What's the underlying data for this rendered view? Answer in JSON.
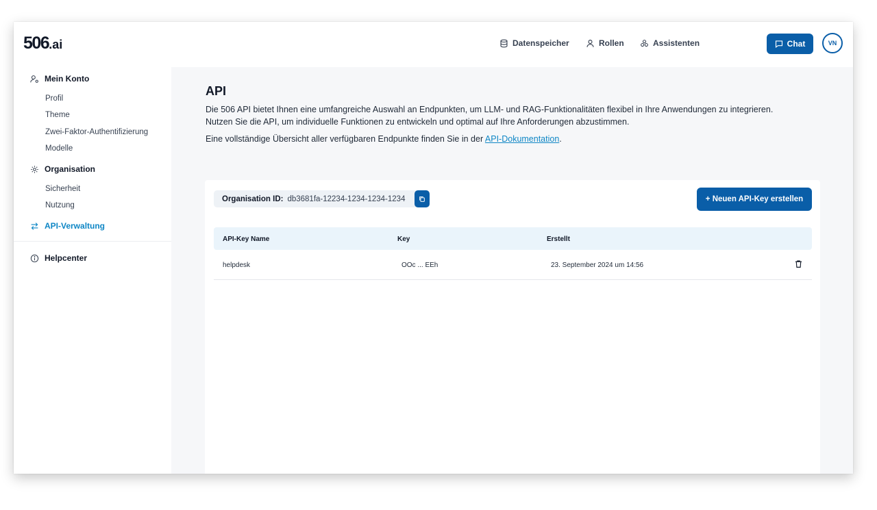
{
  "brand": {
    "logo_main": "506",
    "logo_suffix": ".ai"
  },
  "header": {
    "nav": [
      {
        "label": "Datenspeicher",
        "icon": "database-icon"
      },
      {
        "label": "Rollen",
        "icon": "user-icon"
      },
      {
        "label": "Assistenten",
        "icon": "assistants-icon"
      }
    ],
    "chat_label": "Chat",
    "avatar_initials": "VN"
  },
  "sidebar": {
    "account": {
      "title": "Mein Konto",
      "items": [
        "Profil",
        "Theme",
        "Zwei-Faktor-Authentifizierung",
        "Modelle"
      ]
    },
    "organisation": {
      "title": "Organisation",
      "items": [
        "Sicherheit",
        "Nutzung"
      ]
    },
    "api": {
      "title": "API-Verwaltung",
      "active": true
    },
    "help": {
      "title": "Helpcenter"
    }
  },
  "main": {
    "title": "API",
    "desc_line1": "Die 506 API bietet Ihnen eine umfangreiche Auswahl an Endpunkten, um LLM- und RAG-Funktionalitäten flexibel in Ihre Anwendungen zu integrieren.",
    "desc_line2": "Nutzen Sie die API, um individuelle Funktionen zu entwickeln und optimal auf Ihre Anforderungen abzustimmen.",
    "desc_line3_prefix": "Eine vollständige Übersicht aller verfügbaren Endpunkte finden Sie in der ",
    "desc_link": "API-Dokumentation",
    "desc_line3_suffix": "."
  },
  "org": {
    "label": "Organisation ID:",
    "value": "db3681fa-12234-1234-1234-1234"
  },
  "new_key_label": "+ Neuen API-Key erstellen",
  "table": {
    "headers": [
      "API-Key Name",
      "Key",
      "Erstellt"
    ],
    "rows": [
      {
        "name": "helpdesk",
        "key": "OOc ... EEh",
        "created": "23. September 2024 um 14:56"
      }
    ]
  },
  "colors": {
    "primary": "#0a5ea8",
    "accent": "#0e86c5",
    "table_header": "#eaf4fb"
  }
}
